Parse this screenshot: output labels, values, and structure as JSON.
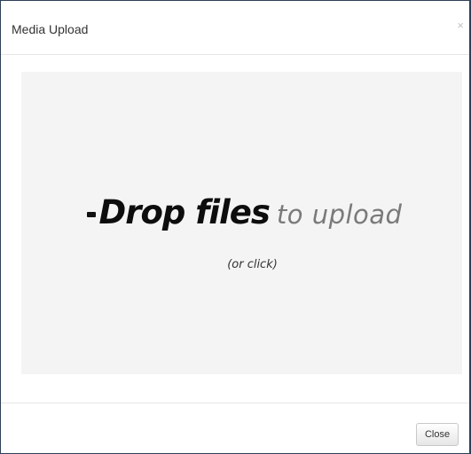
{
  "modal": {
    "title": "Media Upload",
    "close_icon_glyph": "×",
    "close_icon": "close-icon"
  },
  "dropzone": {
    "headline_strong": "Drop files",
    "headline_light": "to upload",
    "subtext": "(or click)"
  },
  "footer": {
    "close_label": "Close"
  },
  "colors": {
    "border": "#2e3f57",
    "dropzone_bg": "#f4f4f4"
  }
}
